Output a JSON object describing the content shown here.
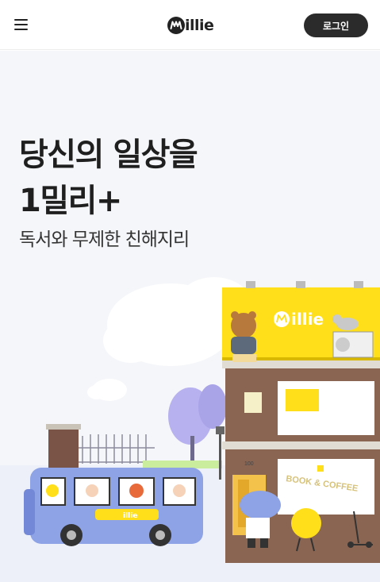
{
  "header": {
    "menu_icon": "hamburger-menu-icon",
    "logo_text": "illie",
    "login_label": "로그인"
  },
  "hero": {
    "headline_line1": "당신의 일상을",
    "headline_line2": "1밀리+",
    "subhead": "독서와 무제한 친해지리"
  },
  "illustration": {
    "billboard_text": "illie",
    "sign_text": "BOOK & COFFEE",
    "bus_logo": "illie",
    "door_number": "100"
  },
  "colors": {
    "accent_yellow": "#ffde1a",
    "bus_blue": "#8ea3e6",
    "login_bg": "#2b2b2b",
    "hero_bg": "#f5f6f9"
  }
}
